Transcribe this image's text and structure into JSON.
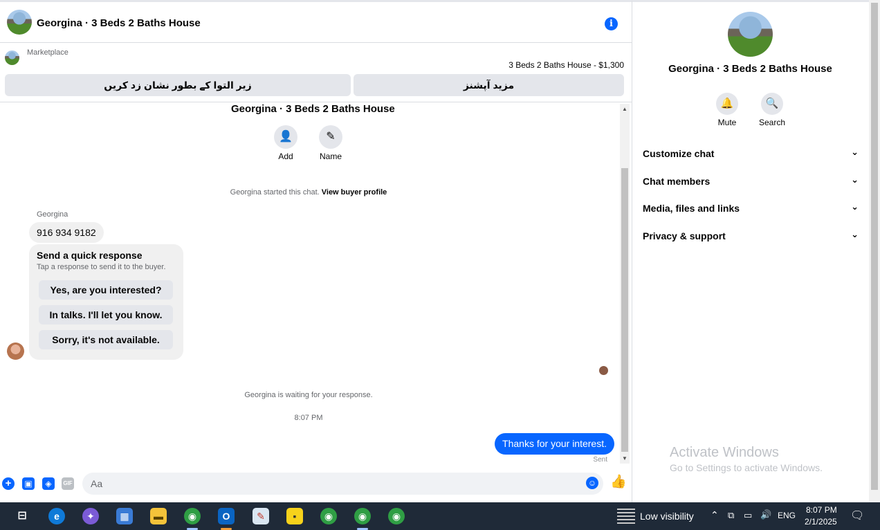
{
  "header": {
    "title": "Georgina · 3 Beds 2 Baths House",
    "info_icon": "info-icon"
  },
  "marketplace": {
    "label": "Marketplace",
    "listing": "3 Beds 2 Baths House - $1,300",
    "mark_pending_label": "زیر التوا کے بطور نشان زد کریں",
    "more_options_label": "مزید آپشنز"
  },
  "conversation": {
    "title": "Georgina · 3 Beds 2 Baths House",
    "add_label": "Add",
    "name_label": "Name",
    "started_text": "Georgina started this chat.",
    "view_profile_link": "View buyer profile",
    "sender_name": "Georgina",
    "phone_message": "916 934 9182",
    "quick_response": {
      "title": "Send a quick response",
      "subtitle": "Tap a response to send it to the buyer.",
      "options": [
        "Yes, are you interested?",
        "In talks. I'll let you know.",
        "Sorry, it's not available."
      ]
    },
    "waiting_text": "Georgina is waiting for your response.",
    "time": "8:07 PM",
    "sent_message": "Thanks for your interest.",
    "sent_status": "Sent"
  },
  "composer": {
    "placeholder": "Aa"
  },
  "right_panel": {
    "title": "Georgina · 3 Beds 2 Baths House",
    "mute_label": "Mute",
    "search_label": "Search",
    "sections": [
      "Customize chat",
      "Chat members",
      "Media, files and links",
      "Privacy & support"
    ]
  },
  "watermark": {
    "title": "Activate Windows",
    "subtitle": "Go to Settings to activate Windows."
  },
  "taskbar": {
    "weather": "Low visibility",
    "language": "ENG",
    "time": "8:07 PM",
    "date": "2/1/2025"
  },
  "colors": {
    "accent": "#0866ff",
    "bubble_gray": "#f0f0f0",
    "button_gray": "#e4e6eb",
    "taskbar": "#1f2a38"
  }
}
